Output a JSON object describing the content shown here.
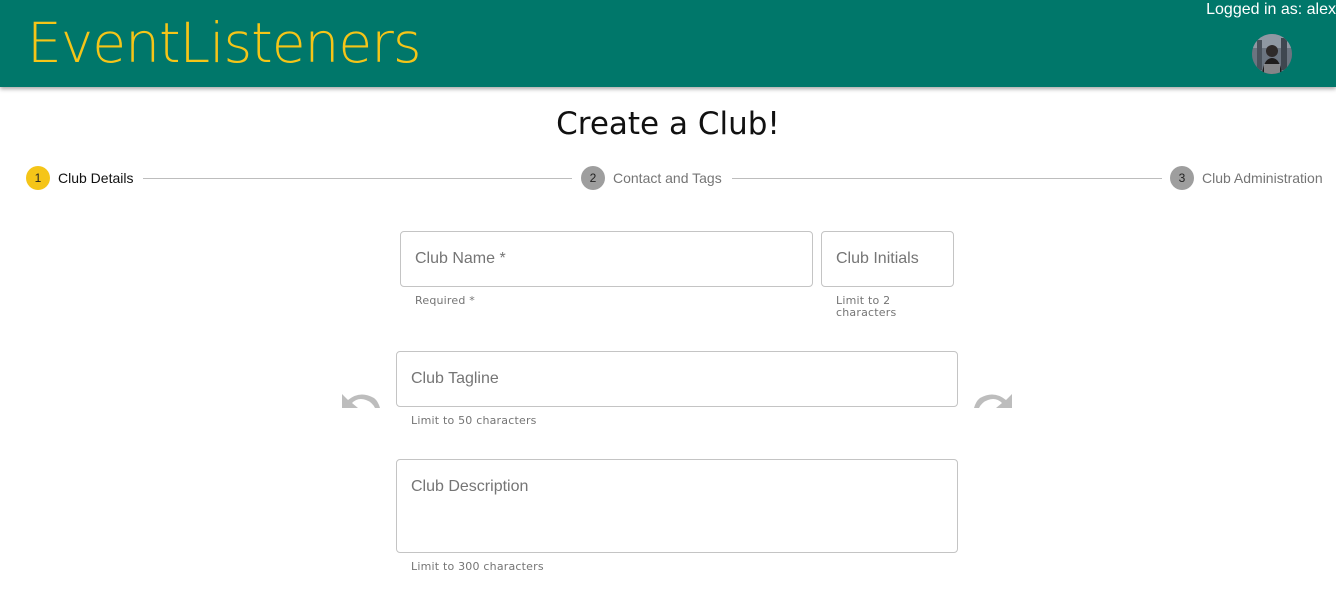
{
  "header": {
    "brand": "EventListeners",
    "login_text": "Logged in as: alex",
    "avatar_alt": "user-avatar"
  },
  "page": {
    "title": "Create a Club!"
  },
  "stepper": {
    "steps": [
      {
        "number": "1",
        "label": "Club Details",
        "state": "active"
      },
      {
        "number": "2",
        "label": "Contact and Tags",
        "state": "inactive"
      },
      {
        "number": "3",
        "label": "Club Administration",
        "state": "inactive"
      }
    ]
  },
  "form": {
    "club_name": {
      "label": "Club Name",
      "required_mark": " *",
      "value": "",
      "helper": "Required *"
    },
    "club_initials": {
      "label": "Club Initials",
      "value": "",
      "helper": "Limit to 2 characters"
    },
    "club_tagline": {
      "label": "Club Tagline",
      "value": "",
      "helper": "Limit to 50 characters"
    },
    "club_description": {
      "label": "Club Description",
      "value": "",
      "helper": "Limit to 300 characters"
    }
  },
  "controls": {
    "undo_icon": "undo-icon",
    "redo_icon": "redo-icon"
  },
  "colors": {
    "header_bg": "#00776a",
    "brand": "#f5c518",
    "active_step": "#f5c518",
    "inactive_step": "#9e9e9e"
  }
}
